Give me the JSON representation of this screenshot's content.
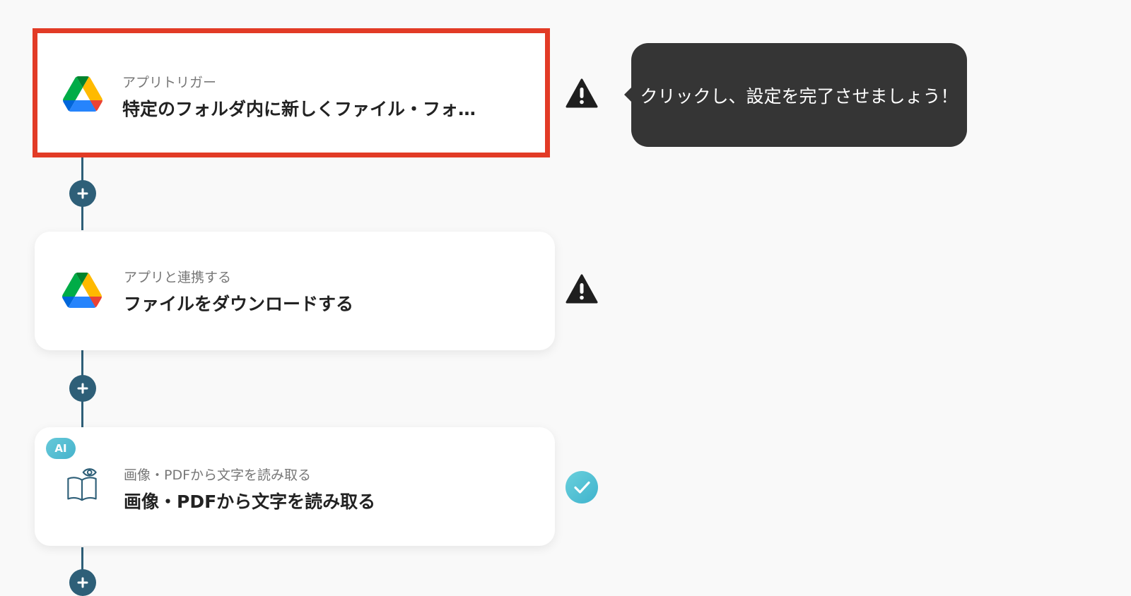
{
  "flow": {
    "steps": [
      {
        "subtitle": "アプリトリガー",
        "title": "特定のフォルダ内に新しくファイル・フォ…",
        "icon": "google-drive-icon",
        "status": "warning-icon",
        "highlighted": true
      },
      {
        "subtitle": "アプリと連携する",
        "title": "ファイルをダウンロードする",
        "icon": "google-drive-icon",
        "status": "warning-icon",
        "highlighted": false
      },
      {
        "subtitle": "画像・PDFから文字を読み取る",
        "title": "画像・PDFから文字を読み取る",
        "icon": "book-eye-icon",
        "status": "check-icon",
        "badge": "AI",
        "highlighted": false
      }
    ],
    "add_step_icon": "plus-icon"
  },
  "tooltip": {
    "text": "クリックし、設定を完了させましょう！"
  },
  "colors": {
    "background": "#f9f9f9",
    "connector": "#2e5f78",
    "highlight_border": "#e23b26",
    "tooltip_bg": "#353535",
    "success_gradient_start": "#6ad0dc",
    "success_gradient_end": "#3fb3cd"
  }
}
